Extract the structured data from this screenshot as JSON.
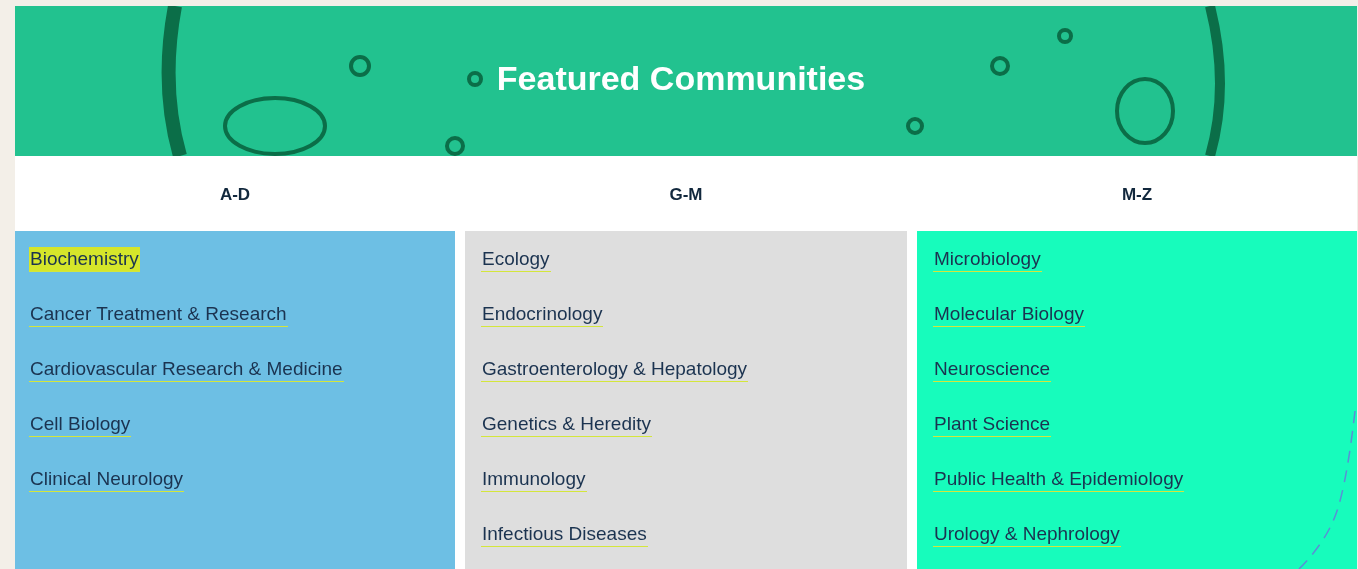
{
  "banner": {
    "title": "Featured Communities"
  },
  "columns": [
    {
      "heading": "A-D",
      "color": "#6dbfe4",
      "links": [
        {
          "label": "Biochemistry",
          "highlighted": true
        },
        {
          "label": "Cancer Treatment & Research",
          "highlighted": false
        },
        {
          "label": "Cardiovascular Research & Medicine",
          "highlighted": false
        },
        {
          "label": "Cell Biology",
          "highlighted": false
        },
        {
          "label": "Clinical Neurology",
          "highlighted": false
        }
      ]
    },
    {
      "heading": "G-M",
      "color": "#dedede",
      "links": [
        {
          "label": "Ecology",
          "highlighted": false
        },
        {
          "label": "Endocrinology",
          "highlighted": false
        },
        {
          "label": "Gastroenterology & Hepatology",
          "highlighted": false
        },
        {
          "label": "Genetics & Heredity",
          "highlighted": false
        },
        {
          "label": "Immunology",
          "highlighted": false
        },
        {
          "label": "Infectious Diseases",
          "highlighted": false
        }
      ]
    },
    {
      "heading": "M-Z",
      "color": "#17fcbc",
      "links": [
        {
          "label": "Microbiology",
          "highlighted": false
        },
        {
          "label": "Molecular Biology",
          "highlighted": false
        },
        {
          "label": "Neuroscience",
          "highlighted": false
        },
        {
          "label": "Plant Science",
          "highlighted": false
        },
        {
          "label": "Public Health & Epidemiology",
          "highlighted": false
        },
        {
          "label": "Urology & Nephrology",
          "highlighted": false
        }
      ]
    }
  ]
}
